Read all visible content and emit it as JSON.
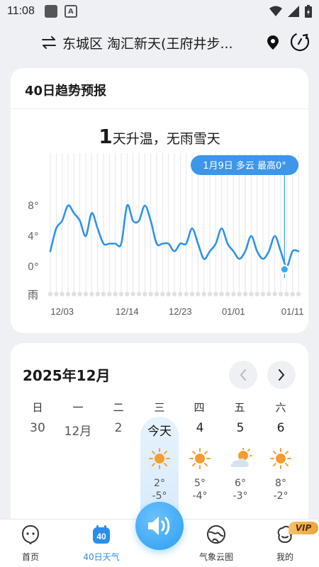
{
  "status_bar": {
    "time": "11:08",
    "a_label": "A"
  },
  "header": {
    "location": "东城区 淘汇新天(王府井步..."
  },
  "trend_card": {
    "title": "40日趋势预报",
    "headline_num": "1",
    "headline_text": "天升温，无雨雪天",
    "tooltip": "1月9日 多云 最高0°",
    "rain_label": "雨"
  },
  "chart_data": {
    "type": "line",
    "title": "40日趋势预报",
    "y_ticks": [
      "8°",
      "4°",
      "0°"
    ],
    "ylim": [
      -4,
      12
    ],
    "x_tick_labels": [
      "12/03",
      "12/14",
      "12/23",
      "01/01",
      "01/11"
    ],
    "x_tick_index": [
      2,
      13,
      22,
      31,
      41
    ],
    "highlight_index": 40,
    "series": [
      {
        "values": [
          2,
          5,
          6,
          8,
          7,
          6,
          4,
          7,
          5,
          3,
          3,
          3,
          3,
          8,
          6,
          6,
          8,
          6,
          3,
          3,
          3,
          2,
          3,
          3,
          5,
          3,
          1,
          2,
          3,
          5,
          3,
          2,
          1,
          2,
          4,
          2,
          1,
          2,
          4,
          2,
          0,
          2,
          2
        ]
      }
    ]
  },
  "calendar": {
    "title": "2025年12月",
    "weekdays": [
      "日",
      "一",
      "二",
      "三",
      "四",
      "五",
      "六"
    ],
    "days": [
      {
        "label": "30"
      },
      {
        "label": "12月"
      },
      {
        "label": "2"
      },
      {
        "label": "今天",
        "icon": "sun-icon",
        "hi": "2°",
        "lo": "-5°"
      },
      {
        "label": "4",
        "icon": "sun-icon",
        "hi": "5°",
        "lo": "-4°"
      },
      {
        "label": "5",
        "icon": "partly-cloudy-icon",
        "hi": "6°",
        "lo": "-3°"
      },
      {
        "label": "6",
        "icon": "sun-icon",
        "hi": "8°",
        "lo": "-2°"
      }
    ]
  },
  "bottom_nav": {
    "items": [
      {
        "label": "首页",
        "icon": "home-icon"
      },
      {
        "label": "40日天气",
        "icon": "calendar-40-icon",
        "active": true,
        "badge": "40"
      },
      {
        "label": "气象云图",
        "icon": "globe-icon"
      },
      {
        "label": "我的",
        "icon": "profile-icon"
      }
    ],
    "vip": "VIP"
  },
  "colors": {
    "accent": "#2b8ee9",
    "line": "#2f93ea",
    "text": "#1a1a1a"
  }
}
